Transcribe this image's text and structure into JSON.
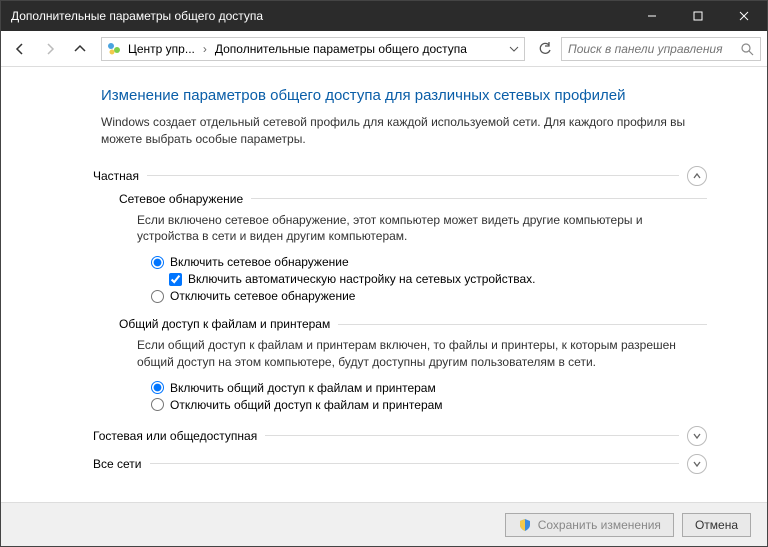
{
  "window": {
    "title": "Дополнительные параметры общего доступа"
  },
  "breadcrumb": {
    "seg1": "Центр упр...",
    "seg2": "Дополнительные параметры общего доступа"
  },
  "search": {
    "placeholder": "Поиск в панели управления"
  },
  "main": {
    "heading": "Изменение параметров общего доступа для различных сетевых профилей",
    "description": "Windows создает отдельный сетевой профиль для каждой используемой сети. Для каждого профиля вы можете выбрать особые параметры."
  },
  "sections": {
    "private": {
      "title": "Частная",
      "discovery": {
        "title": "Сетевое обнаружение",
        "desc": "Если включено сетевое обнаружение, этот компьютер может видеть другие компьютеры и устройства в сети и виден другим компьютерам.",
        "opt_on": "Включить сетевое обнаружение",
        "auto_check": "Включить автоматическую настройку на сетевых устройствах.",
        "opt_off": "Отключить сетевое обнаружение"
      },
      "sharing": {
        "title": "Общий доступ к файлам и принтерам",
        "desc": "Если общий доступ к файлам и принтерам включен, то файлы и принтеры, к которым разрешен общий доступ на этом компьютере, будут доступны другим пользователям в сети.",
        "opt_on": "Включить общий доступ к файлам и принтерам",
        "opt_off": "Отключить общий доступ к файлам и принтерам"
      }
    },
    "guest": {
      "title": "Гостевая или общедоступная"
    },
    "all": {
      "title": "Все сети"
    }
  },
  "footer": {
    "save": "Сохранить изменения",
    "cancel": "Отмена"
  }
}
